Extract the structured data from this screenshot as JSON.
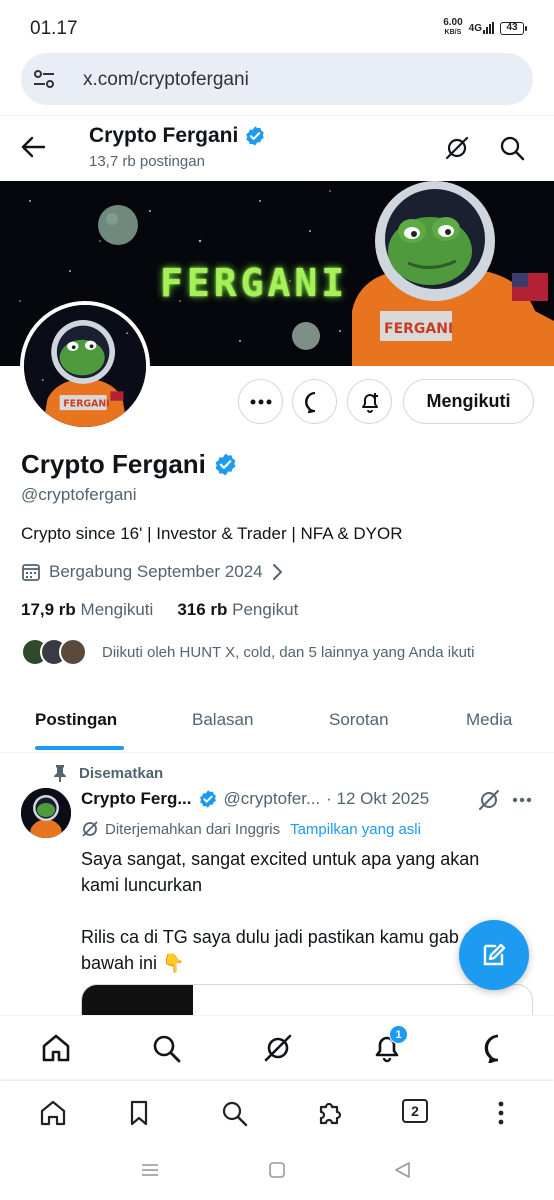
{
  "status": {
    "time": "01.17",
    "net_speed": "6.00",
    "net_unit": "KB/S",
    "network": "4G",
    "battery": "43"
  },
  "browser": {
    "url": "x.com/cryptofergani",
    "tab_count": "2"
  },
  "header": {
    "name": "Crypto Fergani",
    "post_count": "13,7 rb postingan"
  },
  "banner": {
    "title": "FERGANI"
  },
  "actions": {
    "follow_label": "Mengikuti"
  },
  "profile": {
    "name": "Crypto Fergani",
    "handle": "@cryptofergani",
    "bio": "Crypto since 16' | Investor & Trader | NFA & DYOR",
    "joined": "Bergabung September 2024",
    "following_count": "17,9 rb",
    "following_label": "Mengikuti",
    "followers_count": "316 rb",
    "followers_label": "Pengikut",
    "followed_by": "Diikuti oleh HUNT X, cold, dan 5 lainnya yang Anda ikuti"
  },
  "tabs": [
    {
      "label": "Postingan",
      "active": true
    },
    {
      "label": "Balasan",
      "active": false
    },
    {
      "label": "Sorotan",
      "active": false
    },
    {
      "label": "Media",
      "active": false
    }
  ],
  "post": {
    "pinned_label": "Disematkan",
    "author": "Crypto Ferg...",
    "handle": "@cryptofer...",
    "date": "· 12 Okt 2025",
    "translated_label": "Diterjemahkan dari Inggris",
    "show_original": "Tampilkan yang asli",
    "body": "Saya sangat, sangat excited untuk apa yang akan kami luncurkan\n\nRilis ca di TG saya dulu jadi pastikan kamu gab      di bawah ini 👇"
  },
  "bottom_nav": {
    "notification_badge": "1"
  },
  "colors": {
    "accent": "#1d9bf0",
    "text": "#0f1419",
    "muted": "#536471",
    "border": "#cfd9de"
  },
  "icons": [
    "sliders-icon",
    "back-arrow-icon",
    "verified-badge-icon",
    "grok-icon",
    "search-icon",
    "more-icon",
    "message-icon",
    "bell-plus-icon",
    "calendar-icon",
    "chevron-right-icon",
    "pin-icon",
    "translate-icon",
    "compose-icon",
    "home-icon",
    "bell-icon",
    "bookmark-icon",
    "extensions-icon",
    "menu-icon",
    "square-icon",
    "triangle-back-icon"
  ]
}
